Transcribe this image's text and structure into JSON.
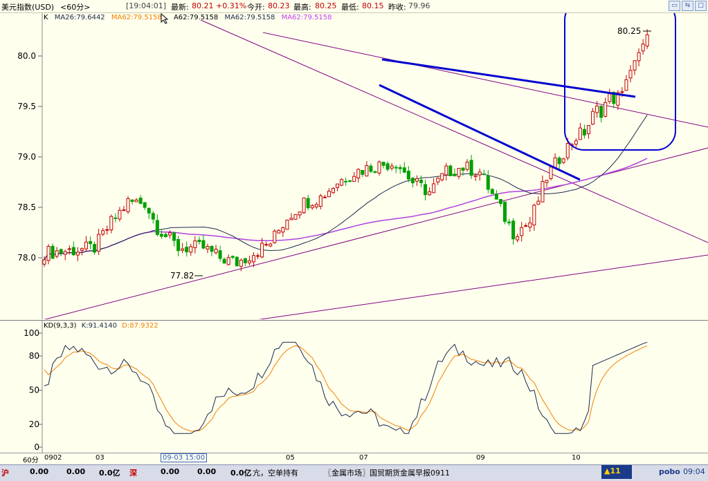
{
  "header": {
    "symbol": "美元指数(USD)",
    "period": "<60分>",
    "time": "[19:04:01]",
    "last_label": "最新:",
    "last_value": "80.21",
    "change": "+0.31%",
    "open_label": "今开:",
    "open_value": "80.23",
    "high_label": "最高:",
    "high_value": "80.25",
    "low_label": "最低:",
    "low_value": "80.15",
    "prev_label": "昨收:",
    "prev_value": "79.96"
  },
  "window_buttons": [
    "▭",
    "⇆",
    "□"
  ],
  "legend": {
    "k": "K",
    "ma26": "MA26:79.6442",
    "ma62a": "MA62:79.5158",
    "ma62b": "A62:79.5158",
    "ma62c": "MA62:79.5158",
    "ma62d": "MA62:79.5158"
  },
  "price_axis": [
    "80.0",
    "79.5",
    "79.0",
    "78.5",
    "78.0"
  ],
  "annotations": {
    "high": "80.25",
    "low": "77.82"
  },
  "kd": {
    "title": "KD(9,3,3)",
    "k": "K:91.4140",
    "d": "D:87.9322",
    "axis": [
      "100",
      "80",
      "50",
      "20",
      "0"
    ]
  },
  "time_axis": {
    "period": "60分",
    "labels": [
      "0902",
      "03",
      "05",
      "07",
      "09",
      "10"
    ],
    "cursor": "09-03 15:00"
  },
  "status": {
    "sh_label": "沪",
    "sh_values": [
      "0.00",
      "0.00",
      "0.0亿"
    ],
    "sz_label": "深",
    "sz_values": [
      "0.00",
      "0.00",
      "0.0亿"
    ],
    "news": "亢，空单持有",
    "news2": "〖金属市场〗国贸期货金属早报0911",
    "alert": "▲11",
    "brand": "pobo",
    "clock": "09:04"
  },
  "colors": {
    "background": "#FFFFEE",
    "up": "#C00000",
    "down": "#00A000",
    "ma26": "#1A2A4A",
    "ma62": "#B040E0",
    "trend": "#800080",
    "drawing": "#0000D0",
    "kd_k": "#1A2A4A",
    "kd_d": "#F08000"
  }
}
